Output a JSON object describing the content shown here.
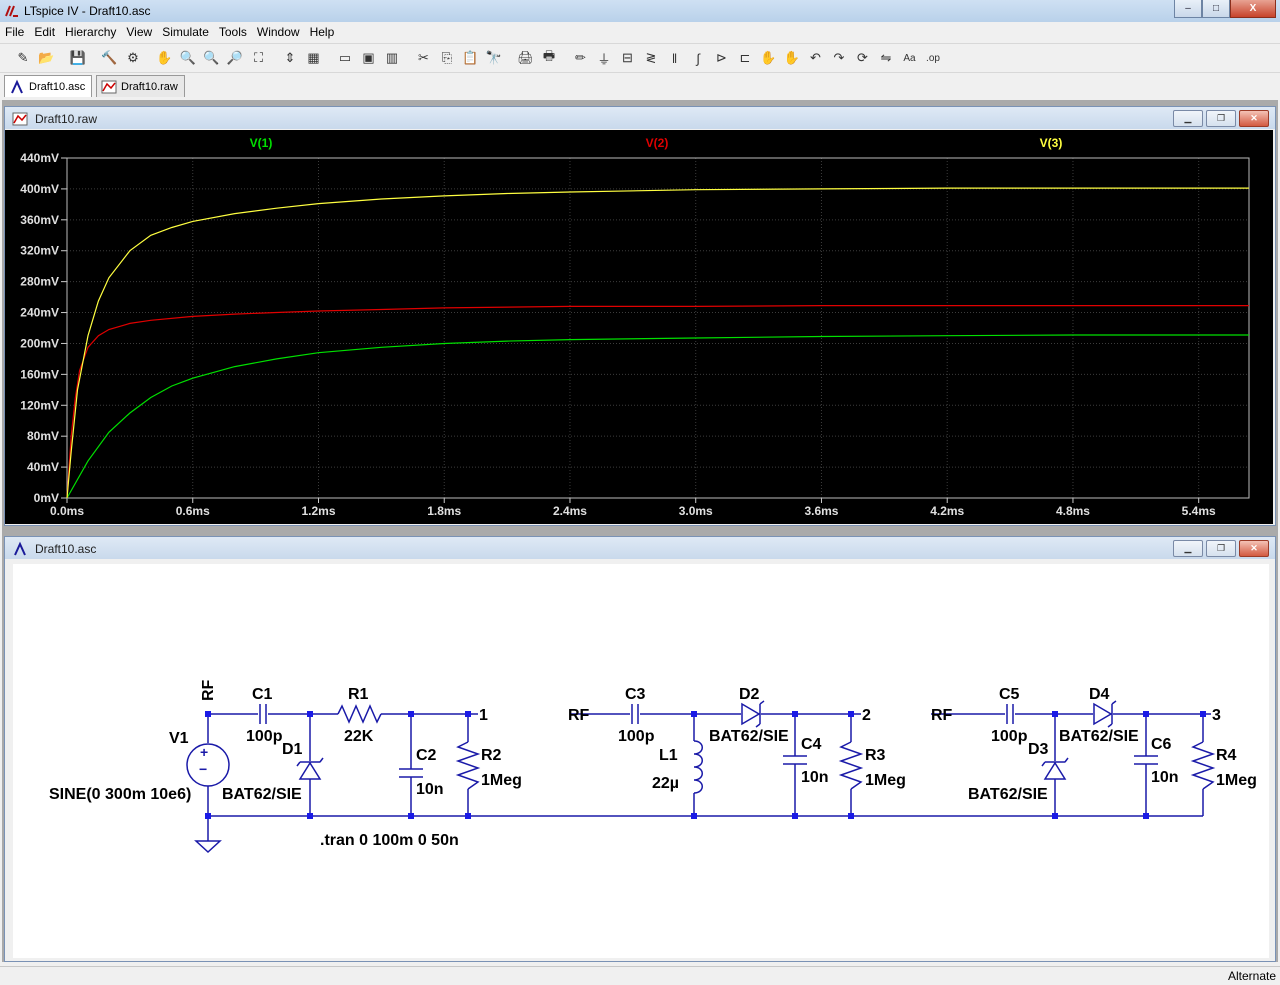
{
  "window": {
    "title": "LTspice IV - Draft10.asc",
    "minimize": "–",
    "maximize": "□",
    "close": "X"
  },
  "menu": [
    "File",
    "Edit",
    "Hierarchy",
    "View",
    "Simulate",
    "Tools",
    "Window",
    "Help"
  ],
  "toolbar": [
    "new-schematic-icon",
    "open-icon",
    "save-icon",
    "control-panel-icon",
    "run-icon",
    "pan-icon",
    "zoom-in-icon",
    "zoom-pan-icon",
    "zoom-out-icon",
    "zoom-fit-icon",
    "autorange-icon",
    "grid-icon",
    "tile-horizontal-icon",
    "cascade-icon",
    "tile-vertical-icon",
    "cut-icon",
    "copy-icon",
    "paste-icon",
    "find-icon",
    "print-setup-icon",
    "print-icon",
    "draw-wire-icon",
    "ground-icon",
    "label-net-icon",
    "resistor-icon",
    "capacitor-icon",
    "inductor-icon",
    "diode-icon",
    "component-icon",
    "move-icon",
    "drag-icon",
    "undo-icon",
    "redo-icon",
    "rotate-icon",
    "mirror-icon",
    "text-icon",
    "spice-directive-icon"
  ],
  "tabs": [
    {
      "label": "Draft10.asc"
    },
    {
      "label": "Draft10.raw"
    }
  ],
  "plot_window": {
    "title": "Draft10.raw"
  },
  "schematic_window": {
    "title": "Draft10.asc"
  },
  "colors": {
    "plot_bg": "#000000",
    "grid": "#3c3c3c",
    "v1": "#00e000",
    "v2": "#e00000",
    "v3": "#ffff40",
    "wire": "#1a1aa8",
    "junction": "#1a1ae6",
    "text": "#000000"
  },
  "chart_data": {
    "type": "line",
    "xlabel": "",
    "ylabel": "",
    "xlim": [
      0,
      5.64
    ],
    "ylim": [
      0,
      440
    ],
    "x_unit": "ms",
    "y_unit": "mV",
    "x_ticks": [
      "0.0ms",
      "0.6ms",
      "1.2ms",
      "1.8ms",
      "2.4ms",
      "3.0ms",
      "3.6ms",
      "4.2ms",
      "4.8ms",
      "5.4ms"
    ],
    "y_ticks": [
      "0mV",
      "40mV",
      "80mV",
      "120mV",
      "160mV",
      "200mV",
      "240mV",
      "280mV",
      "320mV",
      "360mV",
      "400mV",
      "440mV"
    ],
    "series": [
      {
        "name": "V(1)",
        "color": "#00e000",
        "x": [
          0,
          0.1,
          0.2,
          0.3,
          0.4,
          0.5,
          0.6,
          0.8,
          1.0,
          1.2,
          1.5,
          1.8,
          2.1,
          2.4,
          3.0,
          3.6,
          4.2,
          4.8,
          5.4,
          5.64
        ],
        "y": [
          0,
          48,
          85,
          110,
          130,
          145,
          155,
          170,
          180,
          188,
          195,
          200,
          203,
          205,
          207,
          209,
          210,
          211,
          211,
          211
        ]
      },
      {
        "name": "V(2)",
        "color": "#e00000",
        "x": [
          0,
          0.02,
          0.04,
          0.06,
          0.1,
          0.15,
          0.2,
          0.3,
          0.4,
          0.6,
          0.8,
          1.0,
          1.2,
          1.5,
          1.8,
          2.4,
          3.0,
          3.6,
          4.2,
          4.8,
          5.64
        ],
        "y": [
          0,
          80,
          130,
          165,
          195,
          210,
          218,
          226,
          230,
          235,
          238,
          240,
          242,
          244,
          246,
          248,
          248,
          249,
          249,
          249,
          249
        ]
      },
      {
        "name": "V(3)",
        "color": "#ffff40",
        "x": [
          0,
          0.02,
          0.05,
          0.1,
          0.15,
          0.2,
          0.3,
          0.4,
          0.5,
          0.6,
          0.8,
          1.0,
          1.2,
          1.5,
          1.8,
          2.1,
          2.4,
          3.0,
          3.6,
          4.2,
          4.8,
          5.4,
          5.64
        ],
        "y": [
          0,
          60,
          140,
          210,
          255,
          285,
          320,
          340,
          350,
          358,
          368,
          375,
          381,
          387,
          391,
          394,
          396,
          399,
          400,
          401,
          401,
          401,
          401
        ]
      }
    ]
  },
  "schematic": {
    "labels": {
      "rf_v1": "RF",
      "v1_name": "V1",
      "v1_value": "SINE(0 300m 10e6)",
      "c1": "C1",
      "c1v": "100p",
      "d1": "D1",
      "d1v": "BAT62/SIE",
      "r1": "R1",
      "r1v": "22K",
      "c2": "C2",
      "c2v": "10n",
      "r2": "R2",
      "r2v": "1Meg",
      "n1": "1",
      "tran": ".tran 0 100m 0 50n",
      "rf2": "RF",
      "c3": "C3",
      "c3v": "100p",
      "l1": "L1",
      "l1v": "22µ",
      "d2": "D2",
      "d2v": "BAT62/SIE",
      "c4": "C4",
      "c4v": "10n",
      "r3": "R3",
      "r3v": "1Meg",
      "n2": "2",
      "rf3": "RF",
      "c5": "C5",
      "c5v": "100p",
      "d3": "D3",
      "d3v": "BAT62/SIE",
      "d4": "D4",
      "d4v": "BAT62/SIE",
      "c6": "C6",
      "c6v": "10n",
      "r4": "R4",
      "r4v": "1Meg",
      "n3": "3"
    }
  },
  "status": {
    "text": "Alternate"
  }
}
